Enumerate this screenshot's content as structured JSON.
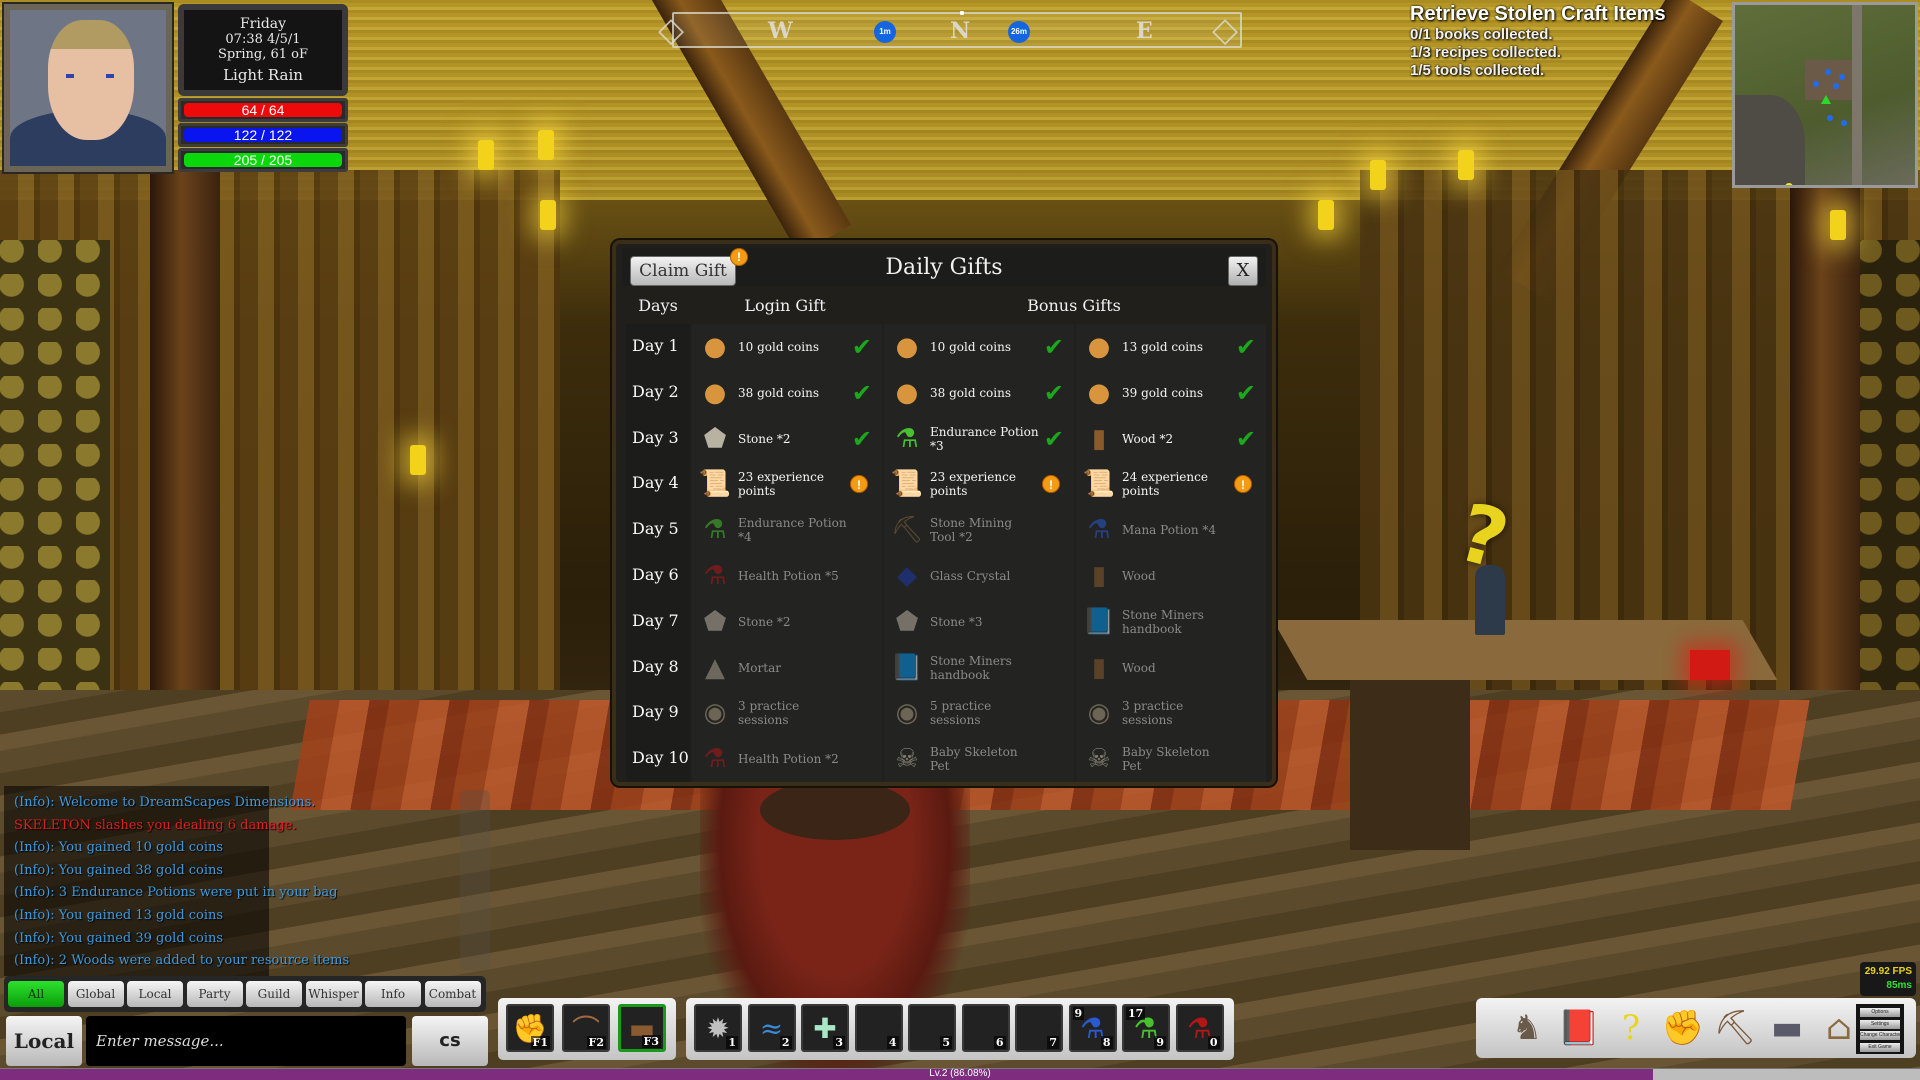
{
  "player": {
    "day": "Friday",
    "time_date": "07:38  4/5/1",
    "season": "Spring,  61 oF",
    "weather": "Light Rain",
    "health": {
      "current": 64,
      "max": 64,
      "label": "64 / 64",
      "color": "#ee0a0a"
    },
    "mana": {
      "current": 122,
      "max": 122,
      "label": "122 / 122",
      "color": "#0a14ee"
    },
    "stamina": {
      "current": 205,
      "max": 205,
      "label": "205 / 205",
      "color": "#0ad80a"
    }
  },
  "compass": {
    "letters": [
      "W",
      "N",
      "E"
    ],
    "markers": [
      {
        "label": "1m"
      },
      {
        "label": "26m"
      }
    ]
  },
  "quest": {
    "title": "Retrieve Stolen Craft Items",
    "objectives": [
      "0/1 books collected.",
      "1/3 recipes collected.",
      "1/5 tools collected."
    ]
  },
  "daily_gifts": {
    "title": "Daily Gifts",
    "claim_label": "Claim Gift",
    "claim_badge": "!",
    "close_label": "X",
    "headers": {
      "days": "Days",
      "login": "Login Gift",
      "bonus": "Bonus Gifts"
    },
    "days": [
      {
        "label": "Day 1",
        "status": "claimed",
        "gifts": [
          {
            "icon": "gold-coins",
            "text": "10 gold coins"
          },
          {
            "icon": "gold-coins",
            "text": "10 gold coins"
          },
          {
            "icon": "gold-coins",
            "text": "13 gold coins"
          }
        ]
      },
      {
        "label": "Day 2",
        "status": "claimed",
        "gifts": [
          {
            "icon": "gold-coins",
            "text": "38 gold coins"
          },
          {
            "icon": "gold-coins",
            "text": "38 gold coins"
          },
          {
            "icon": "gold-coins",
            "text": "39 gold coins"
          }
        ]
      },
      {
        "label": "Day 3",
        "status": "claimed",
        "gifts": [
          {
            "icon": "stone",
            "text": "Stone *2"
          },
          {
            "icon": "endurance-potion",
            "text": "Endurance Potion *3"
          },
          {
            "icon": "wood",
            "text": "Wood *2"
          }
        ]
      },
      {
        "label": "Day 4",
        "status": "current",
        "gifts": [
          {
            "icon": "scroll",
            "text": "23 experience points"
          },
          {
            "icon": "scroll",
            "text": "23 experience points"
          },
          {
            "icon": "scroll",
            "text": "24 experience points"
          }
        ]
      },
      {
        "label": "Day 5",
        "status": "locked",
        "gifts": [
          {
            "icon": "endurance-potion",
            "text": "Endurance Potion *4"
          },
          {
            "icon": "pickaxe",
            "text": "Stone Mining Tool *2"
          },
          {
            "icon": "mana-potion",
            "text": "Mana Potion *4"
          }
        ]
      },
      {
        "label": "Day 6",
        "status": "locked",
        "gifts": [
          {
            "icon": "health-potion",
            "text": "Health Potion *5"
          },
          {
            "icon": "glass-crystal",
            "text": "Glass Crystal"
          },
          {
            "icon": "wood",
            "text": "Wood"
          }
        ]
      },
      {
        "label": "Day 7",
        "status": "locked",
        "gifts": [
          {
            "icon": "stone",
            "text": "Stone *2"
          },
          {
            "icon": "stone",
            "text": "Stone *3"
          },
          {
            "icon": "book",
            "text": "Stone Miners handbook"
          }
        ]
      },
      {
        "label": "Day 8",
        "status": "locked",
        "gifts": [
          {
            "icon": "mortar",
            "text": "Mortar"
          },
          {
            "icon": "book",
            "text": "Stone Miners handbook"
          },
          {
            "icon": "wood",
            "text": "Wood"
          }
        ]
      },
      {
        "label": "Day 9",
        "status": "locked",
        "gifts": [
          {
            "icon": "practice-rune",
            "text": "3 practice sessions"
          },
          {
            "icon": "practice-rune",
            "text": "5 practice sessions"
          },
          {
            "icon": "practice-rune",
            "text": "3 practice sessions"
          }
        ]
      },
      {
        "label": "Day 10",
        "status": "locked",
        "gifts": [
          {
            "icon": "health-potion",
            "text": "Health Potion *2"
          },
          {
            "icon": "skull",
            "text": "Baby Skeleton Pet"
          },
          {
            "icon": "skull",
            "text": "Baby Skeleton Pet"
          }
        ]
      }
    ]
  },
  "chat": {
    "messages": [
      {
        "type": "info",
        "text": "(Info): Welcome to DreamScapes Dimensions."
      },
      {
        "type": "combat",
        "text": "SKELETON slashes you dealing 6 damage."
      },
      {
        "type": "info",
        "text": "(Info): You gained 10 gold coins"
      },
      {
        "type": "info",
        "text": "(Info): You gained 38 gold coins"
      },
      {
        "type": "info",
        "text": "(Info): 3 Endurance Potions were put in your bag"
      },
      {
        "type": "info",
        "text": "(Info): You gained 13 gold coins"
      },
      {
        "type": "info",
        "text": "(Info): You gained 39 gold coins"
      },
      {
        "type": "info",
        "text": "(Info): 2 Woods were added to your resource items"
      }
    ],
    "tabs": [
      "All",
      "Global",
      "Local",
      "Party",
      "Guild",
      "Whisper",
      "Info",
      "Combat"
    ],
    "active_tab": "All",
    "channel": "Local",
    "input_placeholder": "Enter message...",
    "cs_label": "cs"
  },
  "hotbar_weapons": [
    {
      "icon": "fist",
      "key": "F1",
      "selected": false
    },
    {
      "icon": "bow",
      "key": "F2",
      "selected": false
    },
    {
      "icon": "club",
      "key": "F3",
      "selected": true
    }
  ],
  "hotbar_skills": [
    {
      "icon": "spiked-mace",
      "key": "1",
      "count": ""
    },
    {
      "icon": "water-swirl",
      "key": "2",
      "count": ""
    },
    {
      "icon": "healing-cross",
      "key": "3",
      "count": ""
    },
    {
      "icon": "",
      "key": "4",
      "count": ""
    },
    {
      "icon": "",
      "key": "5",
      "count": ""
    },
    {
      "icon": "",
      "key": "6",
      "count": ""
    },
    {
      "icon": "",
      "key": "7",
      "count": ""
    },
    {
      "icon": "mana-potion",
      "key": "8",
      "count": "9"
    },
    {
      "icon": "endurance-potion",
      "key": "9",
      "count": "17"
    },
    {
      "icon": "health-potion",
      "key": "0",
      "count": ""
    }
  ],
  "xp": {
    "label": "Lv.2 (86.08%)",
    "level": 2,
    "progress_percent": 86.08
  },
  "menu": {
    "buttons": [
      "character",
      "spellbook",
      "help-book",
      "skills-fist",
      "gathering-pickaxe",
      "crafting-anvil",
      "building"
    ],
    "system_buttons": [
      "Options",
      "Settings",
      "Change Character",
      "Exit Game"
    ]
  },
  "performance": {
    "fps": "29.92 FPS",
    "latency": "85ms"
  }
}
